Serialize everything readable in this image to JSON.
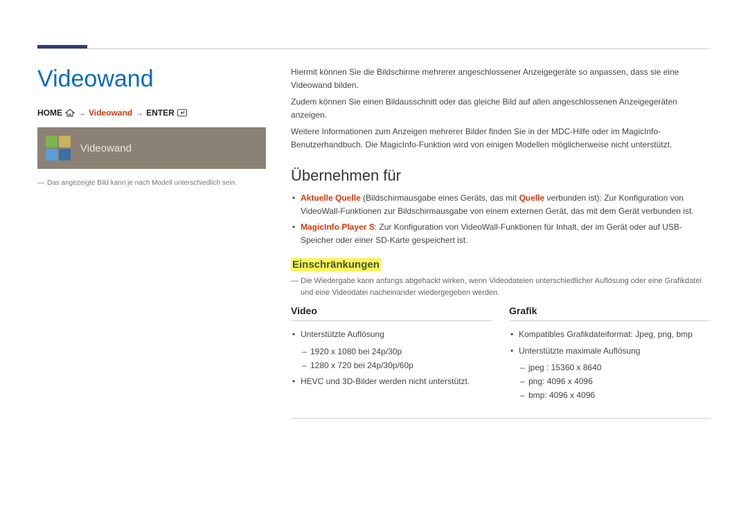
{
  "left": {
    "title": "Videowand",
    "nav": {
      "home": "HOME",
      "arrow": "→",
      "feature": "Videowand",
      "enter": "ENTER"
    },
    "tile_label": "Videowand",
    "footnote": "Das angezeigte Bild kann je nach Modell unterschiedlich sein."
  },
  "intro": {
    "p1": "Hiermit können Sie die Bildschirme mehrerer angeschlossener Anzeigegeräte so anpassen, dass sie eine Videowand bilden.",
    "p2": "Zudem können Sie einen Bildausschnitt oder das gleiche Bild auf allen angeschlossenen Anzeigegeräten anzeigen.",
    "p3": "Weitere Informationen zum Anzeigen mehrerer Bilder finden Sie in der MDC-Hilfe oder im MagicInfo-Benutzerhandbuch. Die MagicInfo-Funktion wird von einigen Modellen möglicherweise nicht unterstützt."
  },
  "apply": {
    "heading": "Übernehmen für",
    "items": [
      {
        "lead": "Aktuelle Quelle",
        "mid_a": " (Bildschirmausgabe eines Geräts, das mit ",
        "mid_bold": "Quelle",
        "mid_b": " verbunden ist): Zur Konfiguration von VideoWall-Funktionen zur Bildschirmausgabe von einem externen Gerät, das mit dem Gerät verbunden ist."
      },
      {
        "lead": "MagicInfo Player S",
        "rest": ": Zur Konfiguration von VideoWall-Funktionen für Inhalt, der im Gerät oder auf USB-Speicher oder einer SD-Karte gespeichert ist."
      }
    ]
  },
  "restrict": {
    "heading": "Einschränkungen",
    "note": "Die Wiedergabe kann anfangs abgehackt wirken, wenn Videodateien unterschiedlicher Auflösung oder eine Grafikdatei und eine Videodatei nacheinander wiedergegeben werden."
  },
  "video": {
    "heading": "Video",
    "b1": "Unterstützte Auflösung",
    "s1": "1920 x 1080 bei 24p/30p",
    "s2": "1280 x 720 bei 24p/30p/60p",
    "b2": "HEVC und 3D-Bilder werden nicht unterstützt."
  },
  "grafik": {
    "heading": "Grafik",
    "b1": "Kompatibles Grafikdateiformat: Jpeg, png, bmp",
    "b2": "Unterstützte maximale Auflösung",
    "s1": "jpeg : 15360 x 8640",
    "s2": "png: 4096 x 4096",
    "s3": "bmp: 4096 x 4096"
  }
}
